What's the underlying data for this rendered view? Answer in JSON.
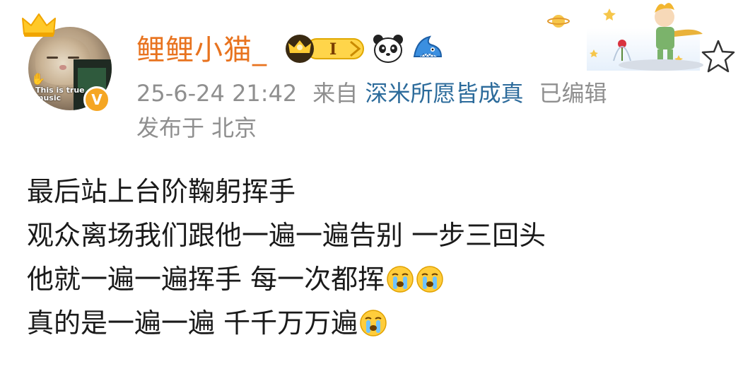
{
  "user": {
    "name": "鲤鲤小猫_",
    "avatar_caption": "This is true music",
    "verified_mark": "V",
    "vip_level": "I"
  },
  "post_meta": {
    "date": "25-6-24 21:42",
    "from_label": "来自",
    "source": "深米所愿皆成真",
    "edited": "已编辑",
    "location": "发布于 北京"
  },
  "post": {
    "lines": [
      {
        "text": "最后站上台阶鞠躬挥手",
        "emojis": 0
      },
      {
        "text": "观众离场我们跟他一遍一遍告别 一步三回头",
        "emojis": 0
      },
      {
        "text": "他就一遍一遍挥手 每一次都挥",
        "emojis": 2
      },
      {
        "text": "真的是一遍一遍 千千万万遍",
        "emojis": 1
      }
    ]
  },
  "icons": {
    "crown": "crown-icon",
    "vip": "vip-crown-badge-icon",
    "panda": "panda-icon",
    "shark": "shark-icon",
    "cry": "crying-face-icon",
    "star": "star-icon"
  },
  "colors": {
    "username": "#e8731f",
    "source_link": "#2c6b9b",
    "meta": "#8f8f8f",
    "vip_badge": "#f5a623"
  }
}
